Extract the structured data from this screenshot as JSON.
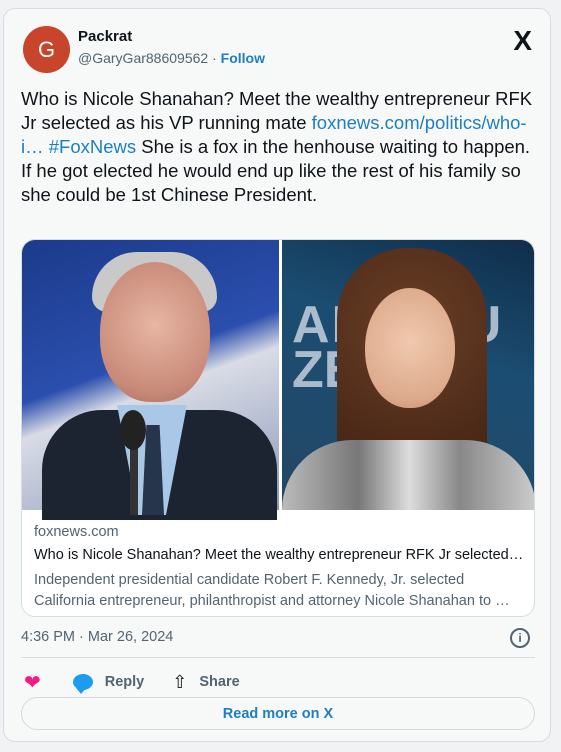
{
  "author": {
    "avatar_letter": "G",
    "name": "Packrat",
    "handle": "@GaryGar88609562",
    "separator": "·",
    "follow_label": "Follow"
  },
  "brand_logo": "X",
  "tweet": {
    "text_part1": "Who is Nicole Shanahan? Meet the wealthy entrepreneur RFK Jr selected as his VP running mate ",
    "link_text": "foxnews.com/politics/who-i…",
    "hashtag": "#FoxNews",
    "text_part2": " She is a fox in the henhouse waiting to happen. If he got elected he would end up like the rest of his family so she could be 1st Chinese President."
  },
  "link_card": {
    "domain": "foxnews.com",
    "title": "Who is Nicole Shanahan? Meet the wealthy entrepreneur RFK Jr selected…",
    "description": "Independent presidential candidate Robert F. Kennedy, Jr. selected California entrepreneur, philanthropist and attorney Nicole Shanahan to …"
  },
  "image_overlay_text": {
    "line1": "AKT OU",
    "line2": "ZE"
  },
  "timestamp": "4:36 PM · Mar 26, 2024",
  "actions": {
    "reply_label": "Reply",
    "share_label": "Share"
  },
  "read_more_label": "Read more on X",
  "colors": {
    "link": "#1d7fc1",
    "heart": "#f91880",
    "avatar_bg": "#c8442b"
  }
}
